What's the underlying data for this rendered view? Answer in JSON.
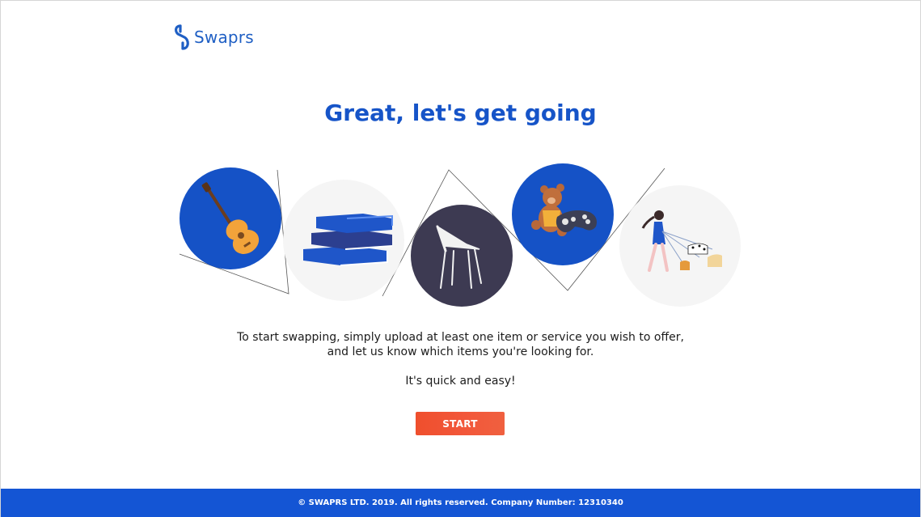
{
  "brand": {
    "name": "Swaprs",
    "logo_icon": "swaprs-s-logo-icon",
    "color": "#1f5fc4"
  },
  "headline": "Great, let's get going",
  "illustrations": [
    {
      "name": "guitar",
      "icon": "guitar-icon",
      "circle_color": "#1552c6"
    },
    {
      "name": "books",
      "icon": "books-icon",
      "circle_color": "#f5f5f5"
    },
    {
      "name": "chair",
      "icon": "chair-icon",
      "circle_color": "#3d3a52"
    },
    {
      "name": "toys",
      "icon": "teddy-bear-gamepad-icon",
      "circle_color": "#1552c6"
    },
    {
      "name": "dog-walking",
      "icon": "dog-walker-icon",
      "circle_color": "#f5f5f5"
    }
  ],
  "description": {
    "line1": "To start swapping, simply upload at least one item or service you wish to offer,",
    "line2": "and let us know which items you're looking for.",
    "tagline": "It's quick and easy!"
  },
  "cta": {
    "label": "START",
    "color": "#f0532f"
  },
  "footer": {
    "text": "© SWAPRS LTD. 2019. All rights reserved. Company Number: 12310340",
    "color": "#1455d4"
  }
}
